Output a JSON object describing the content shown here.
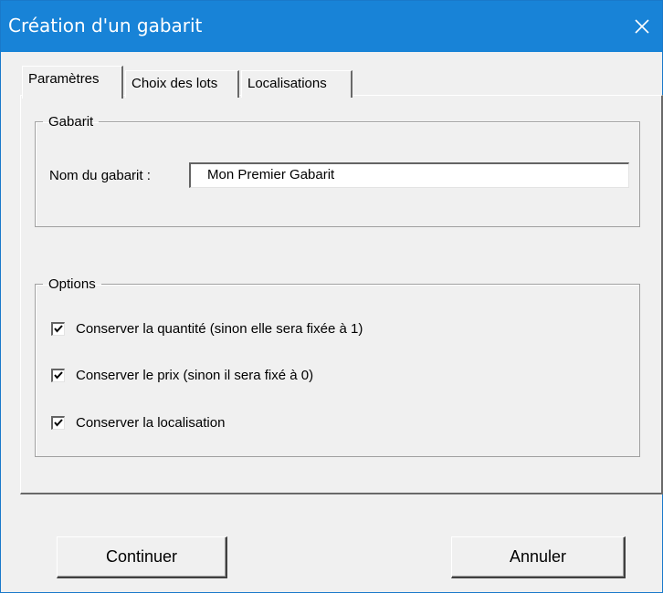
{
  "window": {
    "title": "Création d'un gabarit",
    "close_icon": "close-icon"
  },
  "tabs": [
    {
      "label": "Paramètres",
      "active": true
    },
    {
      "label": "Choix des lots",
      "active": false
    },
    {
      "label": "Localisations",
      "active": false
    }
  ],
  "gabarit_group": {
    "legend": "Gabarit",
    "name_label": "Nom du gabarit :",
    "name_value": "Mon Premier Gabarit"
  },
  "options_group": {
    "legend": "Options",
    "items": [
      {
        "label": "Conserver la quantité (sinon elle sera fixée à 1)",
        "checked": true
      },
      {
        "label": "Conserver le prix (sinon il sera fixé à 0)",
        "checked": true
      },
      {
        "label": "Conserver la localisation",
        "checked": true
      }
    ]
  },
  "buttons": {
    "continue_label": "Continuer",
    "cancel_label": "Annuler"
  },
  "colors": {
    "titlebar": "#1883d7",
    "dialog_background": "#f0f0f0"
  }
}
